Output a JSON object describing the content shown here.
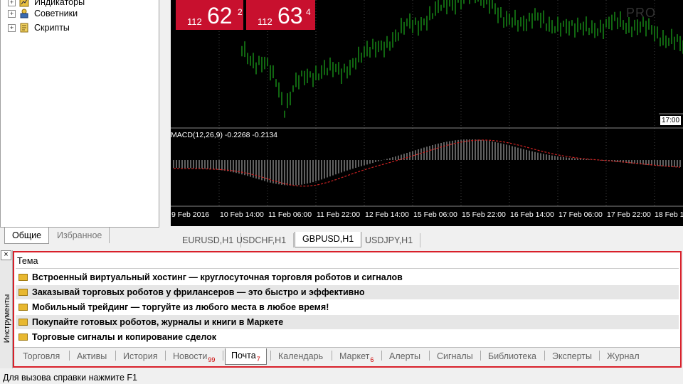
{
  "navigator": {
    "items": [
      {
        "label": "Индикаторы",
        "icon": "indicators-icon"
      },
      {
        "label": "Советники",
        "icon": "experts-icon"
      },
      {
        "label": "Скрипты",
        "icon": "scripts-icon"
      }
    ],
    "tabs": {
      "common": "Общие",
      "favorites": "Избранное"
    }
  },
  "chart": {
    "bid": {
      "prefix": "112",
      "big": "62",
      "sup": "2"
    },
    "ask": {
      "prefix": "112",
      "big": "63",
      "sup": "4"
    },
    "watermark": "PRO",
    "time_marker": "17:00",
    "macd_label": "MACD(12,26,9) -0.2268 -0.2134",
    "time_axis": [
      "9 Feb 2016",
      "10 Feb 14:00",
      "11 Feb 06:00",
      "11 Feb 22:00",
      "12 Feb 14:00",
      "15 Feb 06:00",
      "15 Feb 22:00",
      "16 Feb 14:00",
      "17 Feb 06:00",
      "17 Feb 22:00",
      "18 Feb 1"
    ],
    "colors": {
      "candles": "#22cc22",
      "histogram": "#c0c0c0",
      "signal": "#cc2222",
      "background": "#000000"
    }
  },
  "chart_tabs": [
    "EURUSD,H1",
    "USDCHF,H1",
    "GBPUSD,H1",
    "USDJPY,H1"
  ],
  "chart_tabs_active": "GBPUSD,H1",
  "toolbox": {
    "side_label": "Инструменты",
    "close_glyph": "×",
    "column_header": "Тема",
    "messages": [
      "Встроенный виртуальный хостинг — круглосуточная торговля роботов и сигналов",
      "Заказывай торговых роботов у фрилансеров — это быстро и эффективно",
      "Мобильный трейдинг — торгуйте из любого места в любое время!",
      "Покупайте готовых роботов, журналы и книги в Маркете",
      "Торговые сигналы и копирование сделок"
    ],
    "tabs": [
      {
        "label": "Торговля"
      },
      {
        "label": "Активы"
      },
      {
        "label": "История"
      },
      {
        "label": "Новости",
        "badge": "99"
      },
      {
        "label": "Почта",
        "badge": "7"
      },
      {
        "label": "Календарь"
      },
      {
        "label": "Маркет",
        "badge": "6"
      },
      {
        "label": "Алерты"
      },
      {
        "label": "Сигналы"
      },
      {
        "label": "Библиотека"
      },
      {
        "label": "Эксперты"
      },
      {
        "label": "Журнал"
      }
    ],
    "active_tab": "Почта"
  },
  "status": "Для вызова справки нажмите F1"
}
